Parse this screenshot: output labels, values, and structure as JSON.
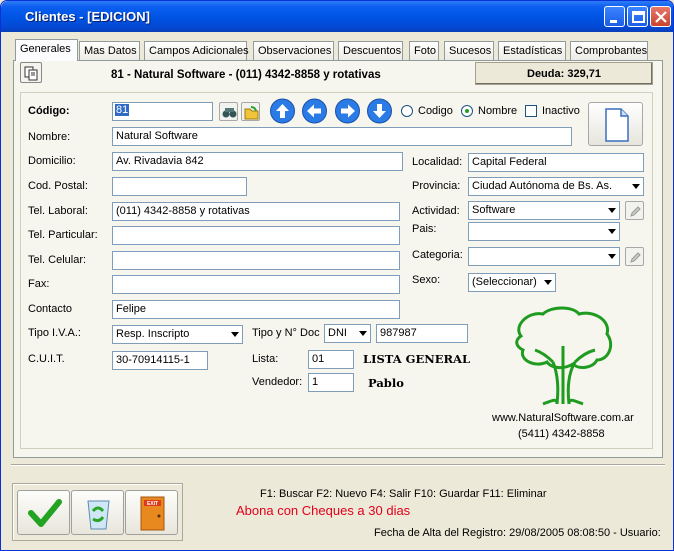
{
  "window": {
    "title": "Clientes - [EDICION]"
  },
  "tabs": [
    {
      "label": "Generales"
    },
    {
      "label": "Mas Datos"
    },
    {
      "label": "Campos Adicionales"
    },
    {
      "label": "Observaciones"
    },
    {
      "label": "Descuentos"
    },
    {
      "label": "Foto"
    },
    {
      "label": "Sucesos"
    },
    {
      "label": "Estadísticas"
    },
    {
      "label": "Comprobantes"
    }
  ],
  "header": {
    "summary": "81 - Natural Software - (011)  4342-8858   y rotativas",
    "debt": "Deuda: 329,71"
  },
  "search": {
    "order_codigo": "Codigo",
    "order_nombre": "Nombre",
    "inactivo": "Inactivo"
  },
  "form": {
    "codigo_label": "Código:",
    "codigo": "81",
    "nombre_label": "Nombre:",
    "nombre": "Natural Software",
    "domicilio_label": "Domicilio:",
    "domicilio": "Av. Rivadavia 842",
    "cp_label": "Cod. Postal:",
    "cp": "",
    "tel_laboral_label": "Tel. Laboral:",
    "tel_laboral": "(011)  4342-8858   y rotativas",
    "tel_particular_label": "Tel. Particular:",
    "tel_particular": "",
    "tel_celular_label": "Tel. Celular:",
    "tel_celular": "",
    "fax_label": "Fax:",
    "fax": "",
    "contacto_label": "Contacto",
    "contacto": "Felipe",
    "tipo_iva_label": "Tipo I.V.A.:",
    "tipo_iva": "Resp. Inscripto",
    "tipo_doc_label": "Tipo y N° Doc",
    "tipo_doc": "DNI",
    "nro_doc": "987987",
    "cuit_label": "C.U.I.T.",
    "cuit": "30-70914115-1",
    "lista_label": "Lista:",
    "lista": "01",
    "lista_name": "LISTA GENERAL",
    "vendedor_label": "Vendedor:",
    "vendedor": "1",
    "vendedor_name": "Pablo",
    "localidad_label": "Localidad:",
    "localidad": "Capital Federal",
    "provincia_label": "Provincia:",
    "provincia": "Ciudad Autónoma de Bs. As.",
    "actividad_label": "Actividad:",
    "actividad": "Software",
    "pais_label": "Pais:",
    "pais": "",
    "categoria_label": "Categoria:",
    "categoria": "",
    "sexo_label": "Sexo:",
    "sexo": "(Seleccionar)"
  },
  "branding": {
    "site": "www.NaturalSoftware.com.ar",
    "phone": "(5411) 4342-8858",
    "tree_color": "#1f9b1f"
  },
  "footer": {
    "shortcuts": "F1: Buscar  F2: Nuevo  F4: Salir  F10: Guardar  F11: Eliminar",
    "warning": "Abona con Cheques a 30 dias",
    "status": "Fecha de Alta del Registro: 29/08/2005 08:08:50 - Usuario:"
  }
}
